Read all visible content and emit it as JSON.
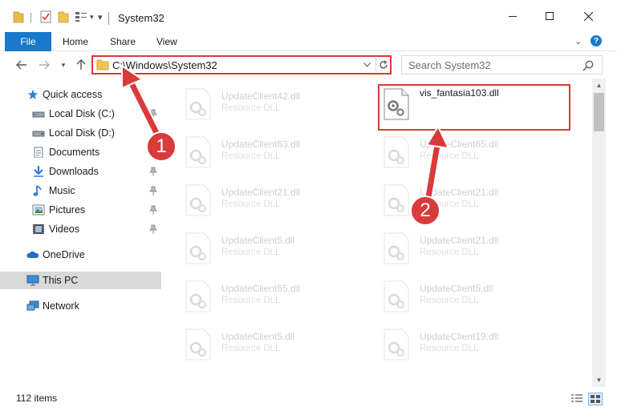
{
  "window": {
    "title": "System32"
  },
  "ribbon": {
    "tabs": [
      "File",
      "Home",
      "Share",
      "View"
    ]
  },
  "address": {
    "path": "C:\\Windows\\System32"
  },
  "search": {
    "placeholder": "Search System32"
  },
  "sidebar": {
    "items": [
      {
        "label": "Quick access",
        "icon": "star-icon",
        "pinned": false
      },
      {
        "label": "Local Disk (C:)",
        "icon": "drive-icon",
        "pinned": true
      },
      {
        "label": "Local Disk (D:)",
        "icon": "drive-icon",
        "pinned": false
      },
      {
        "label": "Documents",
        "icon": "documents-icon",
        "pinned": true
      },
      {
        "label": "Downloads",
        "icon": "download-icon",
        "pinned": true
      },
      {
        "label": "Music",
        "icon": "music-icon",
        "pinned": true
      },
      {
        "label": "Pictures",
        "icon": "pictures-icon",
        "pinned": true
      },
      {
        "label": "Videos",
        "icon": "videos-icon",
        "pinned": true
      },
      {
        "label": "OneDrive",
        "icon": "cloud-icon",
        "pinned": false
      },
      {
        "label": "This PC",
        "icon": "computer-icon",
        "pinned": false,
        "selected": true
      },
      {
        "label": "Network",
        "icon": "network-icon",
        "pinned": false
      }
    ]
  },
  "files": {
    "left": [
      {
        "name": "UpdateClient42.dll",
        "type": "Resource DLL"
      },
      {
        "name": "UpdateClient63.dll",
        "type": "Resource DLL"
      },
      {
        "name": "UpdateClient21.dll",
        "type": "Resource DLL"
      },
      {
        "name": "UpdateClient5.dll",
        "type": "Resource DLL"
      },
      {
        "name": "UpdateClient65.dll",
        "type": "Resource DLL"
      },
      {
        "name": "UpdateClient5.dll",
        "type": "Resource DLL"
      }
    ],
    "right": [
      {
        "name": "vis_fantasia103.dll",
        "type": ""
      },
      {
        "name": "UpdateClient65.dll",
        "type": "Resource DLL"
      },
      {
        "name": "UpdateClient21.dll",
        "type": "Resource DLL"
      },
      {
        "name": "UpdateClient21.dll",
        "type": "Resource DLL"
      },
      {
        "name": "UpdateClient5.dll",
        "type": "Resource DLL"
      },
      {
        "name": "UpdateClient19.dll",
        "type": "Resource DLL"
      }
    ]
  },
  "status": {
    "item_count": "112 items"
  },
  "annotations": {
    "step1": "1",
    "step2": "2",
    "color": "#d93a3a"
  },
  "colors": {
    "accent": "#1979ca",
    "highlight": "#d93a3a",
    "selected_nav": "#d9d9d9"
  }
}
